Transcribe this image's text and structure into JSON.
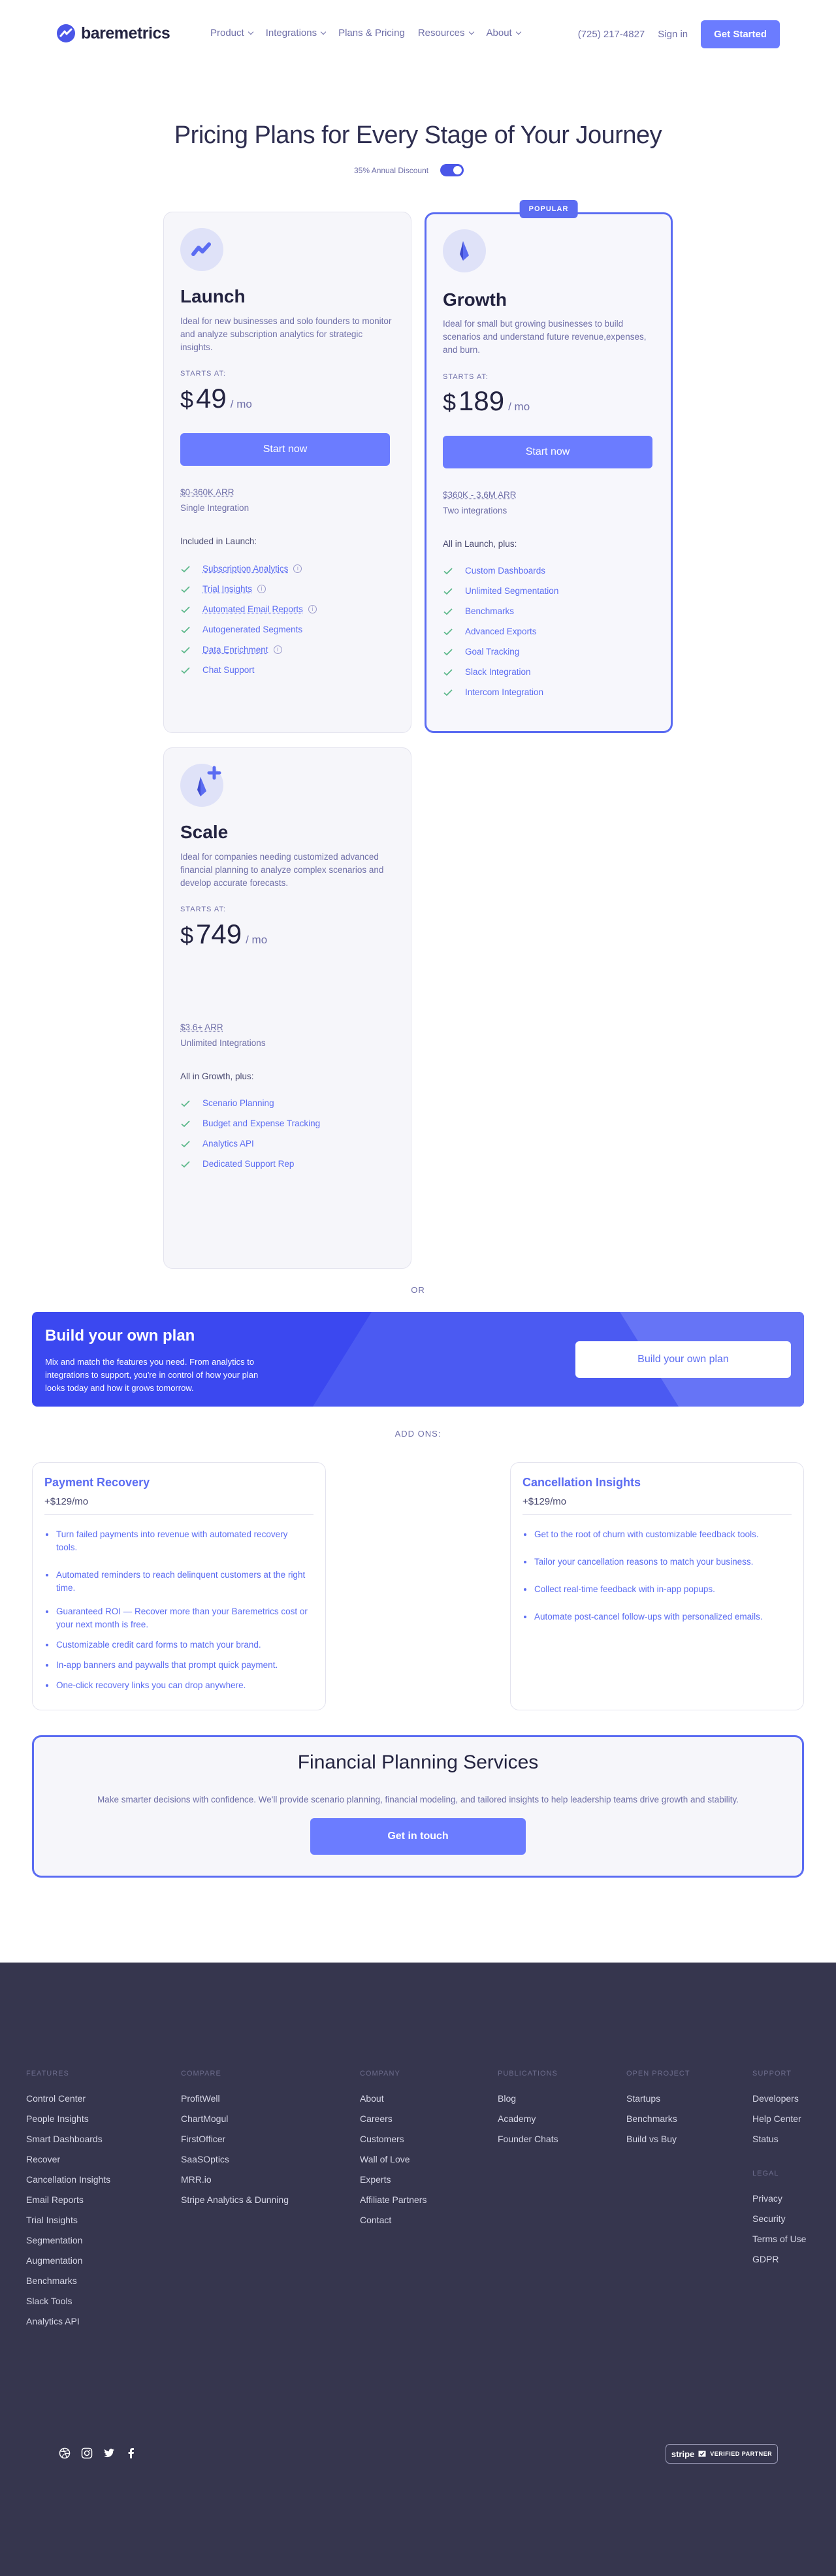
{
  "header": {
    "brand": "baremetrics",
    "nav": [
      {
        "label": "Product",
        "dropdown": true
      },
      {
        "label": "Integrations",
        "dropdown": true
      },
      {
        "label": "Plans & Pricing",
        "dropdown": false
      },
      {
        "label": "Resources",
        "dropdown": true
      },
      {
        "label": "About",
        "dropdown": true
      }
    ],
    "phone": "(725) 217-4827",
    "sign_in": "Sign in",
    "get_started": "Get Started"
  },
  "pricing": {
    "title": "Pricing Plans for Every Stage of Your Journey",
    "discount_label": "35% Annual Discount",
    "discount_on": true
  },
  "plans": {
    "launch": {
      "name": "Launch",
      "desc": "Ideal for new businesses and solo founders to monitor and analyze subscription analytics for strategic insights.",
      "starts": "STARTS AT:",
      "currency": "$",
      "price": "49",
      "per": "/ mo",
      "button": "Start now",
      "arr": "$0-360K ARR",
      "integrations": "Single Integration",
      "included": "Included in Launch:",
      "features": [
        "Subscription Analytics",
        "Trial Insights",
        "Automated Email Reports",
        "Autogenerated Segments",
        "Data Enrichment",
        "Chat Support"
      ]
    },
    "growth": {
      "badge": "POPULAR",
      "name": "Growth",
      "desc": "Ideal for small but growing businesses to build scenarios and understand future revenue,expenses, and burn.",
      "starts": "STARTS AT:",
      "currency": "$",
      "price": "189",
      "per": "/ mo",
      "button": "Start now",
      "arr": "$360K - 3.6M ARR",
      "integrations": "Two integrations",
      "included": "All in Launch, plus:",
      "features": [
        "Custom Dashboards",
        "Unlimited Segmentation",
        "Benchmarks",
        "Advanced Exports",
        "Goal Tracking",
        "Slack Integration",
        "Intercom Integration"
      ]
    },
    "scale": {
      "name": "Scale",
      "desc": "Ideal for companies needing customized advanced financial planning to analyze complex scenarios and develop accurate forecasts.",
      "starts": "STARTS AT:",
      "currency": "$",
      "price": "749",
      "per": "/ mo",
      "arr": "$3.6+ ARR",
      "integrations": "Unlimited Integrations",
      "included": "All in Growth, plus:",
      "features": [
        "Scenario Planning",
        "Budget and Expense Tracking",
        "Analytics API",
        "Dedicated Support Rep"
      ]
    }
  },
  "or_label": "OR",
  "build": {
    "title": "Build your own plan",
    "desc": "Mix and match the features you need. From analytics to integrations to support, you're in control of how your plan looks today and how it grows tomorrow.",
    "button": "Build your own plan"
  },
  "addons_label": "ADD ONS:",
  "addons": {
    "recovery": {
      "title": "Payment Recovery",
      "price": "+$129/mo",
      "items": [
        "Turn failed payments into revenue with automated recovery tools.",
        "Automated reminders to reach delinquent customers at the right time.",
        "Guaranteed ROI — Recover more than your Baremetrics cost or your next month is free.",
        "Customizable credit card forms to match your brand.",
        "In-app banners and paywalls that prompt quick payment.",
        "One-click recovery links you can drop anywhere."
      ]
    },
    "cancellation": {
      "title": "Cancellation Insights",
      "price": "+$129/mo",
      "items": [
        "Get to the root of churn with customizable feedback tools.",
        "Tailor your cancellation reasons to match your business.",
        "Collect real-time feedback with in-app popups.",
        "Automate post-cancel follow-ups with personalized emails."
      ]
    }
  },
  "financial": {
    "title": "Financial Planning Services",
    "desc": "Make smarter decisions with confidence. We'll provide scenario planning, financial modeling, and tailored insights to help leadership teams drive growth and stability.",
    "button": "Get in touch"
  },
  "footer": {
    "features": {
      "head": "FEATURES",
      "items": [
        "Control Center",
        "People Insights",
        "Smart Dashboards",
        "Recover",
        "Cancellation Insights",
        "Email Reports",
        "Trial Insights",
        "Segmentation",
        "Augmentation",
        "Benchmarks",
        "Slack Tools",
        "Analytics API"
      ]
    },
    "compare": {
      "head": "COMPARE",
      "items": [
        "ProfitWell",
        "ChartMogul",
        "FirstOfficer",
        "SaaSOptics",
        "MRR.io",
        "Stripe Analytics & Dunning"
      ]
    },
    "company": {
      "head": "COMPANY",
      "items": [
        "About",
        "Careers",
        "Customers",
        "Wall of Love",
        "Experts",
        "Affiliate Partners",
        "Contact"
      ]
    },
    "publications": {
      "head": "PUBLICATIONS",
      "items": [
        "Blog",
        "Academy",
        "Founder Chats"
      ]
    },
    "open": {
      "head": "OPEN PROJECT",
      "items": [
        "Startups",
        "Benchmarks",
        "Build vs Buy"
      ]
    },
    "support": {
      "head": "SUPPORT",
      "items": [
        "Developers",
        "Help Center",
        "Status"
      ]
    },
    "legal": {
      "head": "LEGAL",
      "items": [
        "Privacy",
        "Security",
        "Terms of Use",
        "GDPR"
      ]
    },
    "social": [
      "dribbble-icon",
      "instagram-icon",
      "twitter-icon",
      "facebook-icon"
    ],
    "stripe_badge": {
      "brand": "stripe",
      "label": "VERIFIED PARTNER"
    }
  },
  "colors": {
    "accent": "#5b6cf2",
    "button": "#6b7cff",
    "footer_bg": "#36364e",
    "check": "#5cb88a"
  }
}
